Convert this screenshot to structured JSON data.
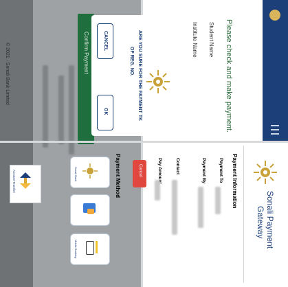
{
  "left": {
    "instruction": "Please check and make payment.",
    "student_name_label": "Student Name",
    "institute_name_label": "Institute Name",
    "confirm_button": "Confirm Payment",
    "copyright": "© 2021 - Sonali Bank Limited",
    "modal": {
      "message_line1": "ARE YOU SURE FOR THE PAYMENT TK",
      "message_line2": "OF REG. NO.",
      "cancel": "CANCEL",
      "ok": "OK"
    }
  },
  "right": {
    "title_line1": "Sonali Payment",
    "title_line2": "Gateway",
    "section_info": "Payment Information",
    "payment_to_label": "Payment To",
    "payment_by_label": "Payment By",
    "contact_label": "Contact",
    "pay_amount_label": "Pay Amount",
    "cancel_button": "Cancel",
    "section_method": "Payment Method",
    "methods": [
      "Sonali Bank",
      "Card",
      "Mobile Banking"
    ],
    "account_transfer": "Account Transfer"
  },
  "colors": {
    "navbar": "#1c3f7a",
    "confirm": "#1f6f3e",
    "cancel": "#e0483f",
    "overlay": "#9fa2a4"
  }
}
